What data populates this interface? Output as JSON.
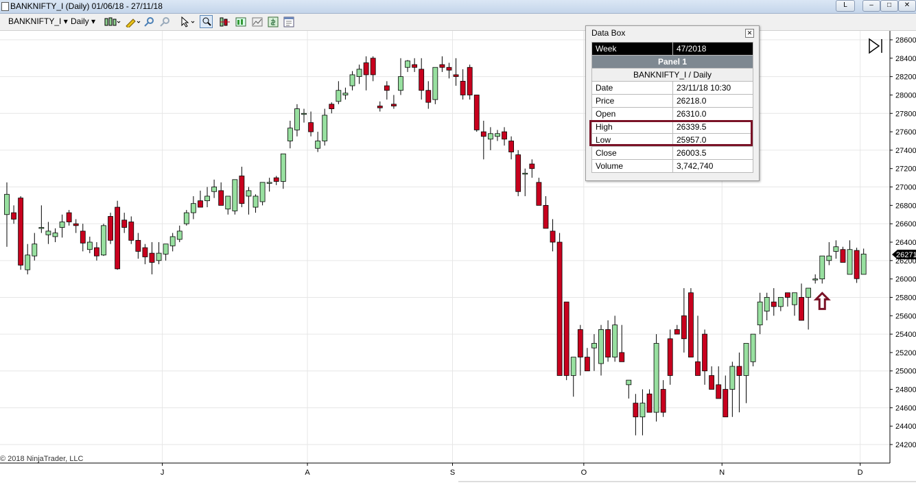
{
  "window": {
    "title": "BANKNIFTY_I (Daily)  01/06/18 - 27/11/18",
    "buttons": [
      "L",
      "–",
      "□",
      "✕"
    ]
  },
  "toolbar": {
    "instrument": "BANKNIFTY_I",
    "interval": "Daily",
    "dropdown_arrow": "▾"
  },
  "databox": {
    "title": "Data Box",
    "close_glyph": "✕",
    "week_label": "Week",
    "week_value": "47/2018",
    "panel_label": "Panel 1",
    "instrument_label": "BANKNIFTY_I / Daily",
    "rows": [
      {
        "label": "Date",
        "value": "23/11/18 10:30"
      },
      {
        "label": "Price",
        "value": "26218.0"
      },
      {
        "label": "Open",
        "value": "26310.0"
      },
      {
        "label": "High",
        "value": "26339.5"
      },
      {
        "label": "Low",
        "value": "25957.0"
      },
      {
        "label": "Close",
        "value": "26003.5"
      },
      {
        "label": "Volume",
        "value": "3,742,740"
      }
    ],
    "highlight_color": "#7a1226"
  },
  "copyright": "© 2018 NinjaTrader, LLC",
  "chart_data": {
    "type": "candlestick",
    "y_ticks": [
      24200,
      24400,
      24600,
      24800,
      25000,
      25200,
      25400,
      25600,
      25800,
      26000,
      26200,
      26400,
      26600,
      26800,
      27000,
      27200,
      27400,
      27600,
      27800,
      28000,
      28200,
      28400,
      28600
    ],
    "ylim": [
      24050,
      28700
    ],
    "x_month_labels": [
      {
        "label": "J",
        "bar": 22.5
      },
      {
        "label": "A",
        "bar": 43.5
      },
      {
        "label": "S",
        "bar": 64.5
      },
      {
        "label": "O",
        "bar": 83.5
      },
      {
        "label": "N",
        "bar": 103.5
      },
      {
        "label": "D",
        "bar": 123.5
      }
    ],
    "price_marker": "26271",
    "grid": true,
    "colors": {
      "up": "#98e0a0",
      "down": "#c8001e",
      "outline": "#000000",
      "grid": "#e6e6e6",
      "arrow": "#7a1226"
    },
    "annotation_arrow_bar": 118,
    "bars": [
      [
        26700,
        27050,
        26350,
        26920
      ],
      [
        26720,
        26800,
        26600,
        26650
      ],
      [
        26880,
        26900,
        26100,
        26150
      ],
      [
        26100,
        26380,
        26050,
        26260
      ],
      [
        26250,
        26500,
        26200,
        26380
      ],
      [
        26550,
        26800,
        26500,
        26560
      ],
      [
        26480,
        26620,
        26380,
        26520
      ],
      [
        26460,
        26550,
        26400,
        26500
      ],
      [
        26560,
        26700,
        26450,
        26620
      ],
      [
        26720,
        26750,
        26580,
        26620
      ],
      [
        26600,
        26650,
        26500,
        26580
      ],
      [
        26520,
        26600,
        26300,
        26390
      ],
      [
        26320,
        26460,
        26280,
        26400
      ],
      [
        26340,
        26400,
        26200,
        26250
      ],
      [
        26260,
        26600,
        26250,
        26580
      ],
      [
        26680,
        26720,
        26380,
        26420
      ],
      [
        26780,
        26850,
        26100,
        26110
      ],
      [
        26640,
        26720,
        26500,
        26560
      ],
      [
        26620,
        26680,
        26380,
        26420
      ],
      [
        26420,
        26500,
        26220,
        26300
      ],
      [
        26340,
        26380,
        26160,
        26240
      ],
      [
        26280,
        26400,
        26050,
        26180
      ],
      [
        26200,
        26400,
        26160,
        26280
      ],
      [
        26270,
        26380,
        26200,
        26380
      ],
      [
        26360,
        26500,
        26300,
        26460
      ],
      [
        26430,
        26580,
        26400,
        26520
      ],
      [
        26600,
        26750,
        26580,
        26720
      ],
      [
        26720,
        26900,
        26650,
        26820
      ],
      [
        26850,
        26960,
        26780,
        26780
      ],
      [
        26850,
        27000,
        26780,
        26900
      ],
      [
        26950,
        27080,
        26880,
        27000
      ],
      [
        26960,
        27050,
        26900,
        26800
      ],
      [
        26760,
        26900,
        26700,
        26900
      ],
      [
        26740,
        27000,
        26700,
        27080
      ],
      [
        27120,
        27220,
        26780,
        26820
      ],
      [
        26900,
        27000,
        26700,
        26960
      ],
      [
        26780,
        26920,
        26720,
        26900
      ],
      [
        26840,
        27050,
        26800,
        27050
      ],
      [
        27050,
        27100,
        26950,
        27050
      ],
      [
        27100,
        27120,
        27020,
        27060
      ],
      [
        27060,
        27250,
        26980,
        27360
      ],
      [
        27500,
        27720,
        27420,
        27640
      ],
      [
        27620,
        27900,
        27550,
        27850
      ],
      [
        27800,
        27850,
        27700,
        27800
      ],
      [
        27700,
        27820,
        27550,
        27600
      ],
      [
        27420,
        27600,
        27380,
        27500
      ],
      [
        27500,
        27850,
        27450,
        27780
      ],
      [
        27900,
        27920,
        27800,
        27850
      ],
      [
        27930,
        28150,
        27900,
        28050
      ],
      [
        28000,
        28080,
        27950,
        28020
      ],
      [
        28100,
        28260,
        28050,
        28220
      ],
      [
        28200,
        28330,
        28120,
        28280
      ],
      [
        28350,
        28420,
        28050,
        28220
      ],
      [
        28400,
        28420,
        28150,
        28220
      ],
      [
        27880,
        27930,
        27820,
        27860
      ],
      [
        28100,
        28150,
        27950,
        28050
      ],
      [
        27900,
        28000,
        27850,
        27880
      ],
      [
        28050,
        28400,
        28000,
        28200
      ],
      [
        28300,
        28380,
        28250,
        28370
      ],
      [
        28330,
        28400,
        28250,
        28300
      ],
      [
        28280,
        28400,
        27950,
        28050
      ],
      [
        28050,
        28150,
        27850,
        27920
      ],
      [
        27950,
        28300,
        27900,
        28300
      ],
      [
        28330,
        28420,
        28250,
        28300
      ],
      [
        28300,
        28350,
        28180,
        28270
      ],
      [
        28220,
        28400,
        28100,
        28200
      ],
      [
        28150,
        28280,
        27950,
        28000
      ],
      [
        28300,
        28330,
        27950,
        28000
      ],
      [
        28000,
        28000,
        27600,
        27620
      ],
      [
        27600,
        27720,
        27300,
        27550
      ],
      [
        27520,
        27650,
        27400,
        27580
      ],
      [
        27550,
        27620,
        27500,
        27580
      ],
      [
        27600,
        27650,
        27450,
        27520
      ],
      [
        27500,
        27550,
        27300,
        27380
      ],
      [
        27350,
        27400,
        26900,
        26950
      ],
      [
        27150,
        27200,
        26900,
        27150
      ],
      [
        27250,
        27300,
        27100,
        27200
      ],
      [
        27050,
        27100,
        26800,
        26800
      ],
      [
        26800,
        26900,
        26550,
        26550
      ],
      [
        26520,
        26650,
        26300,
        26400
      ],
      [
        26400,
        26500,
        24950,
        24950
      ],
      [
        25750,
        25750,
        24900,
        24950
      ],
      [
        24950,
        25100,
        24720,
        25150
      ],
      [
        25450,
        25500,
        24950,
        25150
      ],
      [
        25150,
        25250,
        25000,
        25000
      ],
      [
        25250,
        25400,
        25000,
        25300
      ],
      [
        25080,
        25500,
        24950,
        25450
      ],
      [
        25450,
        25550,
        25100,
        25150
      ],
      [
        25150,
        25600,
        25100,
        25500
      ],
      [
        25200,
        25500,
        25100,
        25100
      ],
      [
        24850,
        24900,
        24700,
        24900
      ],
      [
        24650,
        24750,
        24300,
        24500
      ],
      [
        24500,
        24800,
        24300,
        24650
      ],
      [
        24750,
        24800,
        24600,
        24550
      ],
      [
        24550,
        25400,
        24450,
        25300
      ],
      [
        24800,
        24900,
        24500,
        24550
      ],
      [
        25350,
        25450,
        24850,
        24950
      ],
      [
        25450,
        25500,
        25400,
        25400
      ],
      [
        25600,
        25900,
        25200,
        25350
      ],
      [
        25850,
        25900,
        25150,
        25150
      ],
      [
        25100,
        25600,
        25050,
        24950
      ],
      [
        25400,
        25450,
        24850,
        25000
      ],
      [
        24950,
        25050,
        24800,
        24800
      ],
      [
        24850,
        25050,
        24750,
        24700
      ],
      [
        24800,
        24950,
        24500,
        24500
      ],
      [
        24800,
        25100,
        24500,
        25050
      ],
      [
        25050,
        25200,
        24550,
        24950
      ],
      [
        24950,
        25300,
        24650,
        25300
      ],
      [
        25100,
        25400,
        25050,
        25400
      ],
      [
        25500,
        25850,
        25400,
        25750
      ],
      [
        25650,
        25850,
        25550,
        25800
      ],
      [
        25750,
        25900,
        25600,
        25700
      ],
      [
        25700,
        25800,
        25650,
        25800
      ],
      [
        25850,
        25850,
        25700,
        25800
      ],
      [
        25720,
        25850,
        25600,
        25850
      ],
      [
        25800,
        25950,
        25550,
        25550
      ],
      [
        25800,
        25800,
        25450,
        25900
      ],
      [
        25990,
        26050,
        25950,
        26000
      ],
      [
        26000,
        26250,
        25950,
        26250
      ],
      [
        26200,
        26400,
        26150,
        26250
      ],
      [
        26300,
        26420,
        26220,
        26350
      ],
      [
        26320,
        26350,
        26200,
        26180
      ],
      [
        26050,
        26420,
        26050,
        26320
      ],
      [
        26310,
        26340,
        25957,
        26003
      ],
      [
        26050,
        26330,
        26050,
        26271
      ]
    ]
  }
}
